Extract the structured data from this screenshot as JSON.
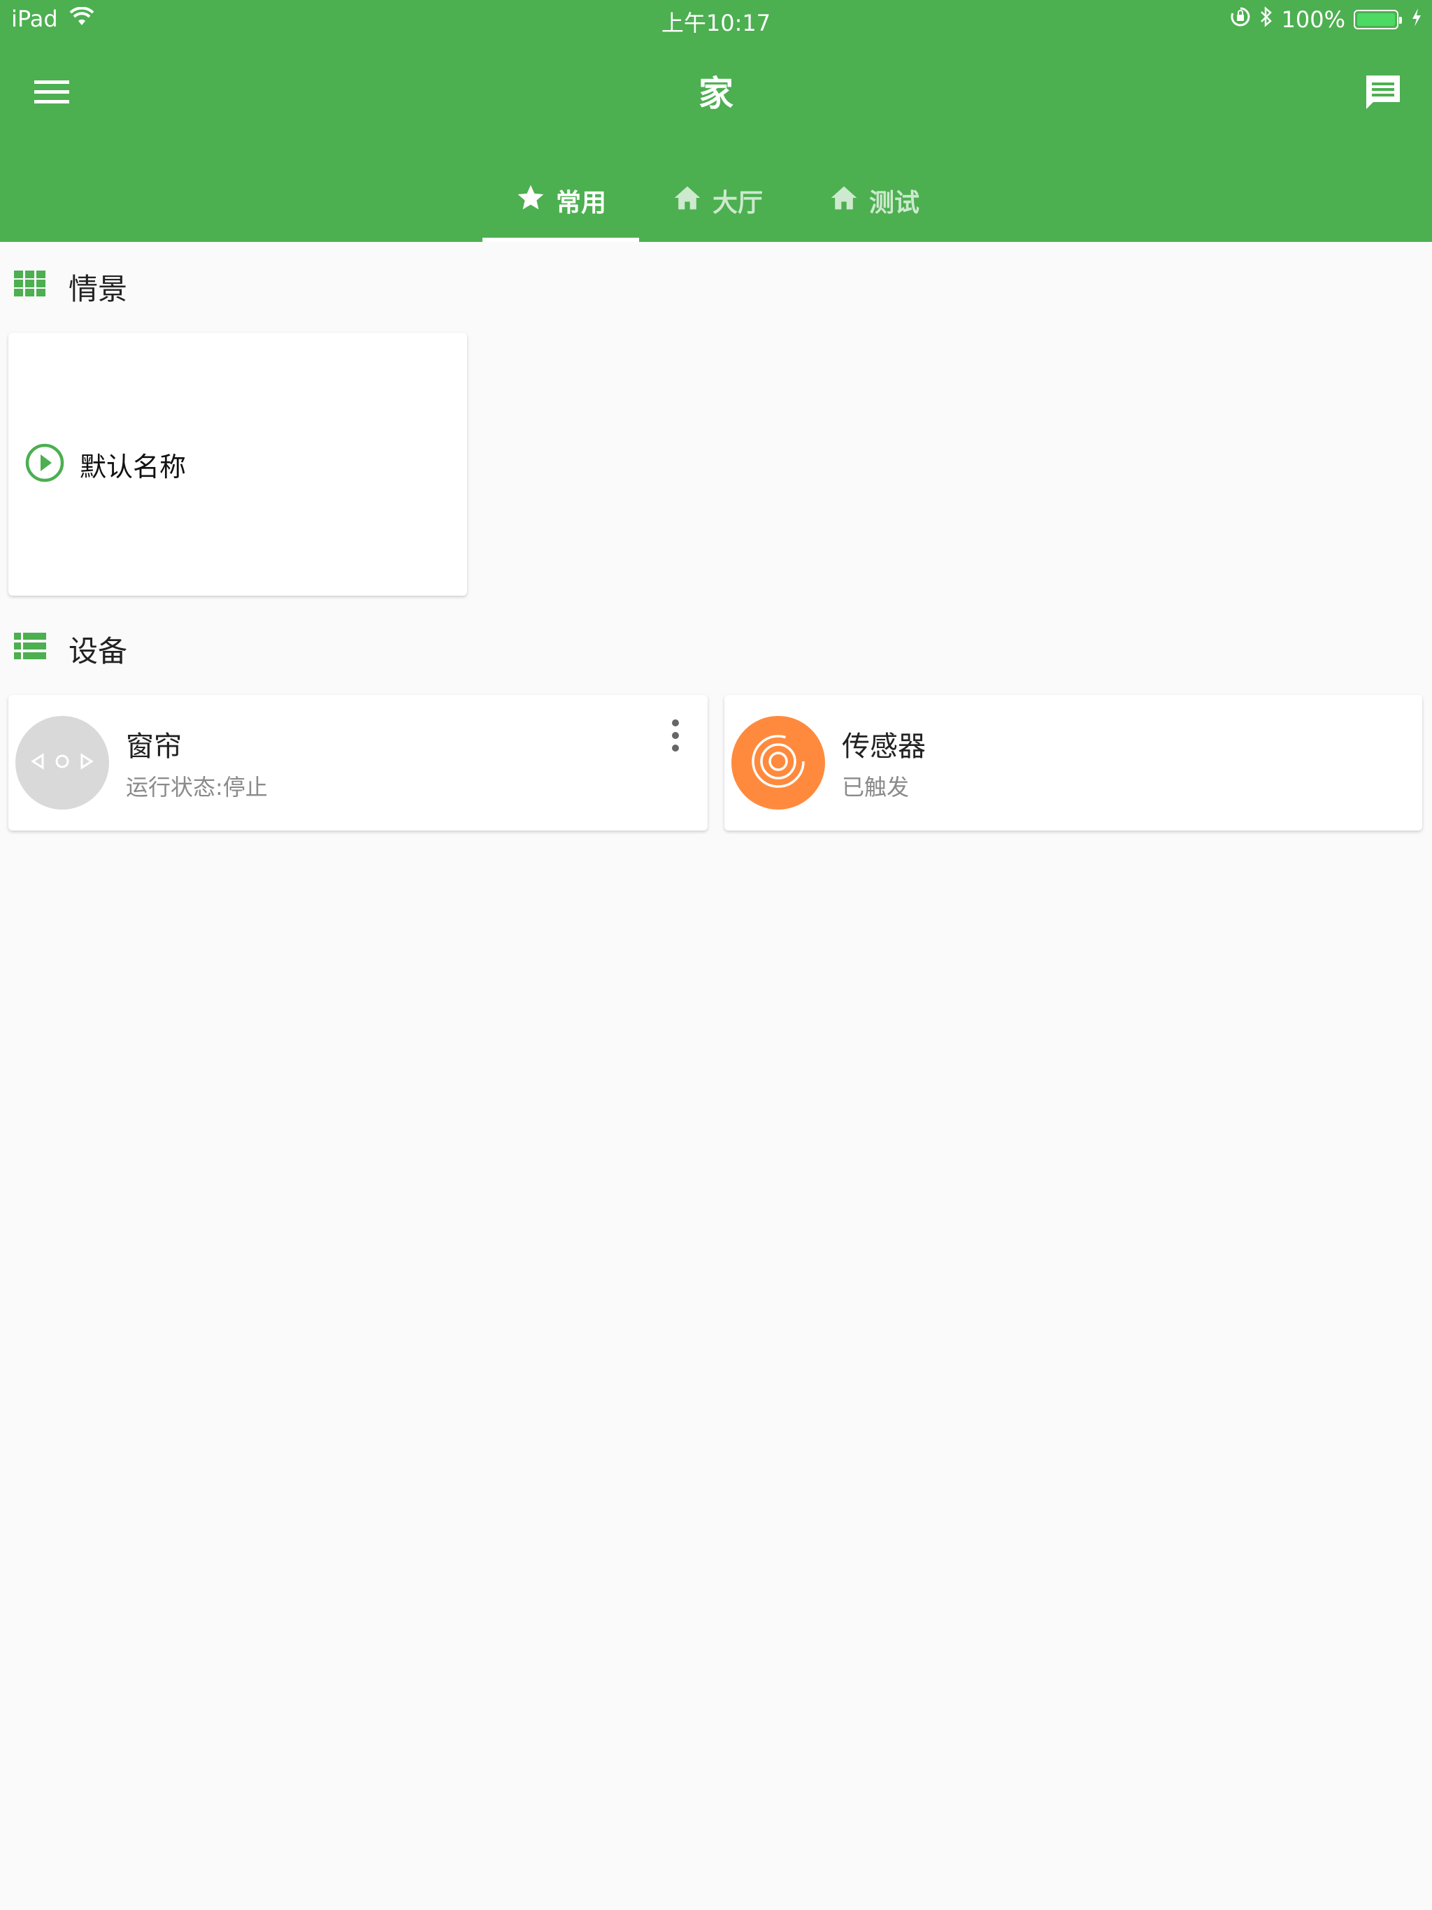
{
  "status_bar": {
    "device": "iPad",
    "time": "上午10:17",
    "battery": "100%",
    "battery_level": 1.0
  },
  "app_bar": {
    "title": "家",
    "menu_icon": "menu-icon",
    "message_icon": "message-icon"
  },
  "tabs": [
    {
      "label": "常用",
      "icon": "star-icon",
      "active": true
    },
    {
      "label": "大厅",
      "icon": "home-icon",
      "active": false
    },
    {
      "label": "测试",
      "icon": "home-icon",
      "active": false
    }
  ],
  "scenes": {
    "title": "情景",
    "icon": "grid-icon",
    "items": [
      {
        "name": "默认名称",
        "icon": "play-circle-icon"
      }
    ]
  },
  "devices": {
    "title": "设备",
    "icon": "list-icon",
    "items": [
      {
        "name": "窗帘",
        "status": "运行状态:停止",
        "icon": "curtain-icon",
        "avatar_color": "#d9d9d9"
      },
      {
        "name": "传感器",
        "status": "已触发",
        "icon": "sensor-icon",
        "avatar_color": "#ff8a3d"
      }
    ]
  },
  "colors": {
    "primary": "#4caf50",
    "sensor": "#ff8a3d",
    "curtain_avatar": "#d9d9d9"
  }
}
